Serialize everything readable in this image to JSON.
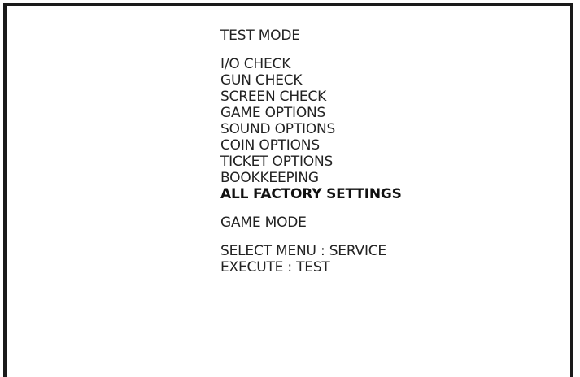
{
  "title": "TEST MODE",
  "menu_items": [
    {
      "label": "I/O CHECK",
      "selected": false
    },
    {
      "label": "GUN CHECK",
      "selected": false
    },
    {
      "label": "SCREEN CHECK",
      "selected": false
    },
    {
      "label": "GAME OPTIONS",
      "selected": false
    },
    {
      "label": "SOUND OPTIONS",
      "selected": false
    },
    {
      "label": "COIN OPTIONS",
      "selected": false
    },
    {
      "label": "TICKET OPTIONS",
      "selected": false
    },
    {
      "label": "BOOKKEEPING",
      "selected": false
    },
    {
      "label": "ALL FACTORY SETTINGS",
      "selected": true
    }
  ],
  "game_mode": "GAME MODE",
  "instructions": {
    "select": "SELECT MENU : SERVICE",
    "execute": "EXECUTE : TEST"
  }
}
